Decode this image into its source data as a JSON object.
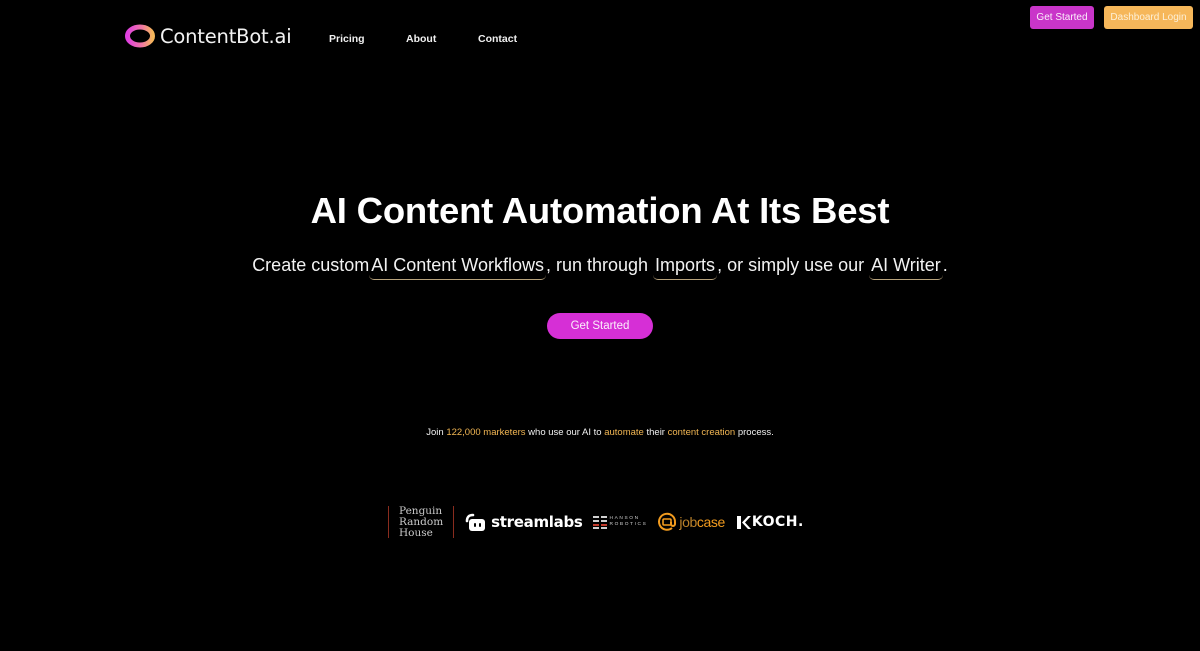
{
  "brand": {
    "name": "ContentBot.ai",
    "logo_icon": "ring-logo-icon",
    "colors": {
      "magenta": "#d62fd6",
      "orange": "#f6b75a",
      "accent_text": "#f1b653",
      "underline": "#b7a27b"
    }
  },
  "nav": {
    "links": [
      "Pricing",
      "About",
      "Contact"
    ],
    "get_started_label": "Get Started",
    "dashboard_label": "Dashboard Login"
  },
  "hero": {
    "title": "AI Content Automation At Its Best",
    "subtitle": {
      "part1": "Create custom",
      "link1": "AI Content Workflows",
      "part2": ", run through ",
      "link2": "Imports",
      "part3": ", or simply use our ",
      "link3": "AI Writer",
      "part4": "."
    },
    "cta_label": "Get Started"
  },
  "social_proof": {
    "t1": "Join ",
    "count": "122,000 marketers",
    "t2": " who use our AI to ",
    "automate": "automate",
    "t3": " their ",
    "content": "content creation",
    "t4": " process."
  },
  "customer_logos": {
    "penguin": [
      "Penguin",
      "Random",
      "House"
    ],
    "streamlabs": "streamlabs",
    "hanson": [
      "HANSON",
      "ROBOTICS"
    ],
    "jobcase_prefix": "job",
    "jobcase_suffix": "case",
    "koch": "KOCH."
  }
}
